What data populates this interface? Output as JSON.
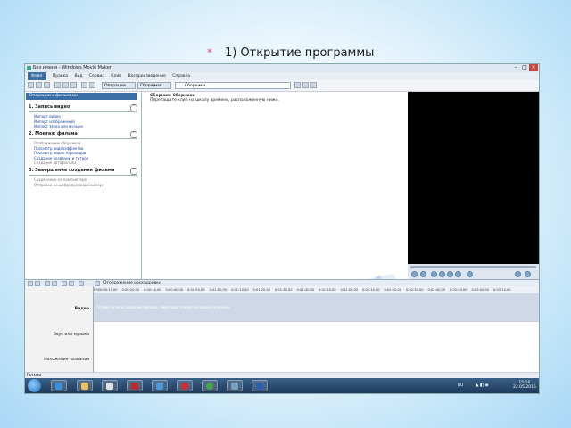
{
  "slide": {
    "bullet": "*",
    "title": "1) Открытие  программы"
  },
  "window": {
    "title": "Без имени - Windows Movie Maker",
    "menu": [
      "Файл",
      "Правка",
      "Вид",
      "Сервис",
      "Клип",
      "Воспроизведение",
      "Справка"
    ],
    "toolbar": {
      "tasks_label": "Операции",
      "collections_label": "Сборники",
      "collections_combo": "Сборники"
    }
  },
  "taskpane": {
    "header": "Операции с фильмами",
    "sections": [
      {
        "title": "1. Запись видео",
        "links": [
          {
            "text": "Импорт видео",
            "enabled": true
          },
          {
            "text": "Импорт изображений",
            "enabled": true
          },
          {
            "text": "Импорт звука или музыки",
            "enabled": true
          }
        ]
      },
      {
        "title": "2. Монтаж фильма",
        "links": [
          {
            "text": "Отображение сборников",
            "enabled": false
          },
          {
            "text": "Просмотр видеоэффектов",
            "enabled": true
          },
          {
            "text": "Просмотр видео переходов",
            "enabled": true
          },
          {
            "text": "Создание названий и титров",
            "enabled": true
          },
          {
            "text": "Создание автофильма",
            "enabled": false
          }
        ]
      },
      {
        "title": "3. Завершение создания фильма",
        "links": [
          {
            "text": "Сохранение на компьютере",
            "enabled": false
          },
          {
            "text": "Отправка на цифровую видеокамеру",
            "enabled": false
          }
        ]
      }
    ]
  },
  "collections": {
    "heading": "Сборник: Сборники",
    "subheading": "Перетащите клип на шкалу времени, расположенную ниже."
  },
  "timeline": {
    "label": "Отображение раскадровки",
    "ruler": [
      "0:00",
      "0:00:10,00",
      "0:00:20,00",
      "0:00:30,00",
      "0:00:40,00",
      "0:00:50,00",
      "0:01:00,00",
      "0:01:10,00",
      "0:01:20,00",
      "0:01:30,00",
      "0:01:40,00",
      "0:01:50,00",
      "0:02:00,00",
      "0:02:10,00",
      "0:02:20,00",
      "0:02:30,00",
      "0:02:40,00",
      "0:02:50,00",
      "0:03:00,00",
      "0:03:10,00"
    ],
    "tracks": {
      "video": "Видео",
      "video_hint": "Чтобы начать создание фильма, перетащите клип на шкалу времени.",
      "audio": "Звук или музыка",
      "title_overlay": "Наложение названия"
    }
  },
  "status": "Готово",
  "taskbar": {
    "lang": "RU",
    "time": "15:16",
    "date": "22.05.2016"
  },
  "colors": {
    "accent": "#3a6ea5",
    "preview_bg": "#000000"
  }
}
